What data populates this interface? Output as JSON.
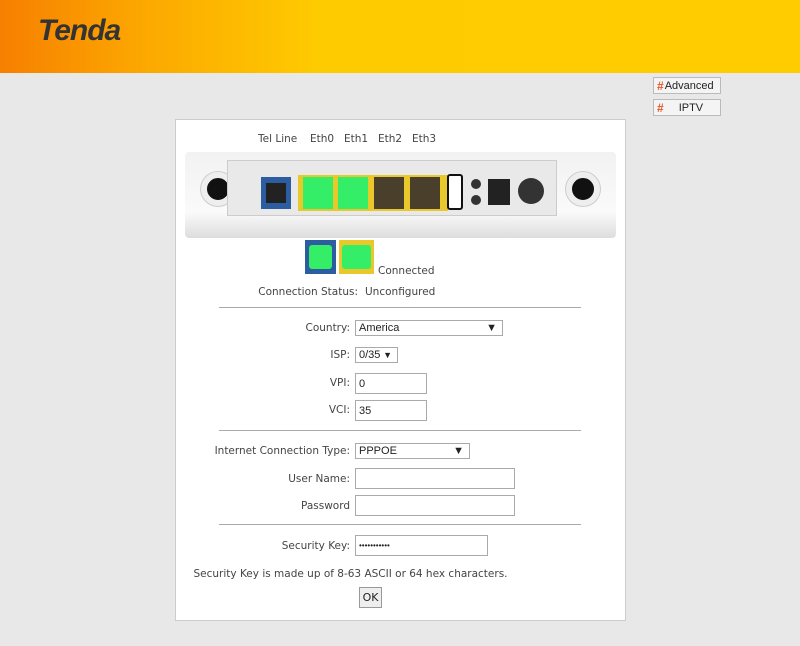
{
  "header": {
    "logo": "Tenda"
  },
  "topbar": {
    "advanced_label": "Advanced",
    "iptv_label": "IPTV"
  },
  "ports": {
    "labels": [
      "Tel Line",
      "Eth0",
      "Eth1",
      "Eth2",
      "Eth3"
    ],
    "legend_label": "Connected"
  },
  "status": {
    "label": "Connection Status:",
    "value": "Unconfigured"
  },
  "form": {
    "country": {
      "label": "Country:",
      "value": "America"
    },
    "isp": {
      "label": "ISP:",
      "value": "0/35"
    },
    "vpi": {
      "label": "VPI:",
      "value": "0"
    },
    "vci": {
      "label": "VCI:",
      "value": "35"
    },
    "conn_type": {
      "label": "Internet Connection Type:",
      "value": "PPPOE"
    },
    "username": {
      "label": "User Name:",
      "value": ""
    },
    "password": {
      "label": "Password",
      "value": ""
    },
    "security_key": {
      "label": "Security Key:",
      "value": "•••••••••••"
    },
    "note": "Security Key is made up of 8-63 ASCII or 64 hex characters.",
    "ok_label": "OK"
  },
  "colors": {
    "connected": "#33ee66",
    "header_yellow": "#ffcc00",
    "header_orange": "#f77f00"
  }
}
